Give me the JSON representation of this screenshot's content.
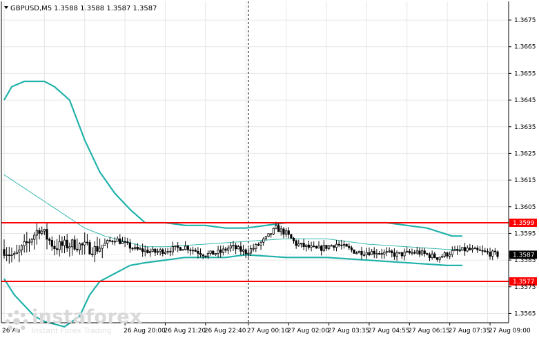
{
  "header": {
    "symbol_label": "GBPUSD,M5",
    "ohlc": "1.3588 1.3588 1.3587 1.3587"
  },
  "watermark": {
    "brand": "instaforex",
    "tagline": "Instant Forex Trading"
  },
  "colors": {
    "background": "#ffffff",
    "grid": "#e6e6e6",
    "candle": "#000000",
    "bands": "#20b2aa",
    "middle_band": "#36b8ae",
    "level_line": "#ff0000",
    "level_label_bg": "#ff0000",
    "price_label_bg": "#000000",
    "label_text": "#ffffff"
  },
  "chart_data": {
    "type": "candlestick",
    "timeframe": "M5",
    "ylim": [
      1.35615,
      1.3682
    ],
    "y_ticks": [
      "1.3675",
      "1.3665",
      "1.3655",
      "1.3645",
      "1.3635",
      "1.3625",
      "1.3615",
      "1.3605",
      "1.3595",
      "1.3585",
      "1.3575",
      "1.3565"
    ],
    "y_tick_values": [
      1.3675,
      1.3665,
      1.3655,
      1.3645,
      1.3635,
      1.3625,
      1.3615,
      1.3605,
      1.3595,
      1.3585,
      1.3575,
      1.3565
    ],
    "x_tick_labels": [
      "26 Aug 20:00",
      "26 Aug 21:20",
      "26 Aug 22:40",
      "27 Aug 00:10",
      "27 Aug 02:00",
      "27 Aug 03:35",
      "27 Aug 04:55",
      "27 Aug 06:15",
      "27 Aug 07:35",
      "27 Aug 09:00"
    ],
    "x_tick_index": [
      48,
      64,
      80,
      97,
      113,
      129,
      145,
      161,
      177,
      193
    ],
    "x_edge_label": "26 Au",
    "bar_count": 197,
    "current_price": {
      "label": "1.3587",
      "value": 1.3587
    },
    "levels": [
      {
        "label": "1.3599",
        "value": 1.3599
      },
      {
        "label": "1.3577",
        "value": 1.3577
      }
    ],
    "session_separator_index": 97,
    "closes_anchors": [
      [
        0,
        1.3589
      ],
      [
        4,
        1.3586
      ],
      [
        8,
        1.359
      ],
      [
        14,
        1.3597
      ],
      [
        20,
        1.359
      ],
      [
        28,
        1.3591
      ],
      [
        36,
        1.3589
      ],
      [
        44,
        1.3593
      ],
      [
        52,
        1.3589
      ],
      [
        60,
        1.3588
      ],
      [
        72,
        1.359
      ],
      [
        80,
        1.3587
      ],
      [
        86,
        1.3588
      ],
      [
        90,
        1.359
      ],
      [
        96,
        1.3588
      ],
      [
        100,
        1.359
      ],
      [
        104,
        1.3593
      ],
      [
        108,
        1.3597
      ],
      [
        112,
        1.3595
      ],
      [
        116,
        1.3591
      ],
      [
        124,
        1.3589
      ],
      [
        132,
        1.3591
      ],
      [
        140,
        1.3588
      ],
      [
        148,
        1.3588
      ],
      [
        156,
        1.3587
      ],
      [
        164,
        1.3588
      ],
      [
        172,
        1.3586
      ],
      [
        178,
        1.3588
      ],
      [
        184,
        1.3589
      ],
      [
        190,
        1.3588
      ],
      [
        196,
        1.3587
      ]
    ],
    "upper_band_anchors": [
      [
        0,
        1.3645
      ],
      [
        3,
        1.365
      ],
      [
        8,
        1.3652
      ],
      [
        16,
        1.3652
      ],
      [
        20,
        1.365
      ],
      [
        26,
        1.3645
      ],
      [
        32,
        1.363
      ],
      [
        38,
        1.3618
      ],
      [
        44,
        1.361
      ],
      [
        50,
        1.3604
      ],
      [
        56,
        1.3599
      ],
      [
        64,
        1.3599
      ],
      [
        72,
        1.3598
      ],
      [
        80,
        1.3598
      ],
      [
        88,
        1.3597
      ],
      [
        96,
        1.3597
      ],
      [
        104,
        1.3598
      ],
      [
        112,
        1.3599
      ],
      [
        120,
        1.3599
      ],
      [
        140,
        1.3599
      ],
      [
        152,
        1.3599
      ],
      [
        160,
        1.3598
      ],
      [
        168,
        1.3597
      ],
      [
        178,
        1.3594
      ],
      [
        182,
        1.3594
      ]
    ],
    "middle_band_anchors": [
      [
        0,
        1.3617
      ],
      [
        8,
        1.3612
      ],
      [
        16,
        1.3607
      ],
      [
        24,
        1.3602
      ],
      [
        32,
        1.3597
      ],
      [
        40,
        1.3594
      ],
      [
        48,
        1.3592
      ],
      [
        56,
        1.359
      ],
      [
        64,
        1.359
      ],
      [
        80,
        1.3591
      ],
      [
        96,
        1.3592
      ],
      [
        112,
        1.3593
      ],
      [
        128,
        1.3593
      ],
      [
        144,
        1.3591
      ],
      [
        160,
        1.359
      ],
      [
        176,
        1.3589
      ],
      [
        182,
        1.3589
      ]
    ],
    "lower_band_anchors": [
      [
        0,
        1.3578
      ],
      [
        4,
        1.3572
      ],
      [
        8,
        1.3568
      ],
      [
        12,
        1.3564
      ],
      [
        16,
        1.3562
      ],
      [
        24,
        1.356
      ],
      [
        30,
        1.3564
      ],
      [
        34,
        1.3572
      ],
      [
        38,
        1.3577
      ],
      [
        44,
        1.358
      ],
      [
        50,
        1.3583
      ],
      [
        56,
        1.3584
      ],
      [
        64,
        1.3585
      ],
      [
        72,
        1.3586
      ],
      [
        88,
        1.3586
      ],
      [
        96,
        1.3587
      ],
      [
        112,
        1.3586
      ],
      [
        128,
        1.3586
      ],
      [
        144,
        1.3585
      ],
      [
        160,
        1.3584
      ],
      [
        176,
        1.3583
      ],
      [
        182,
        1.3583
      ]
    ]
  }
}
